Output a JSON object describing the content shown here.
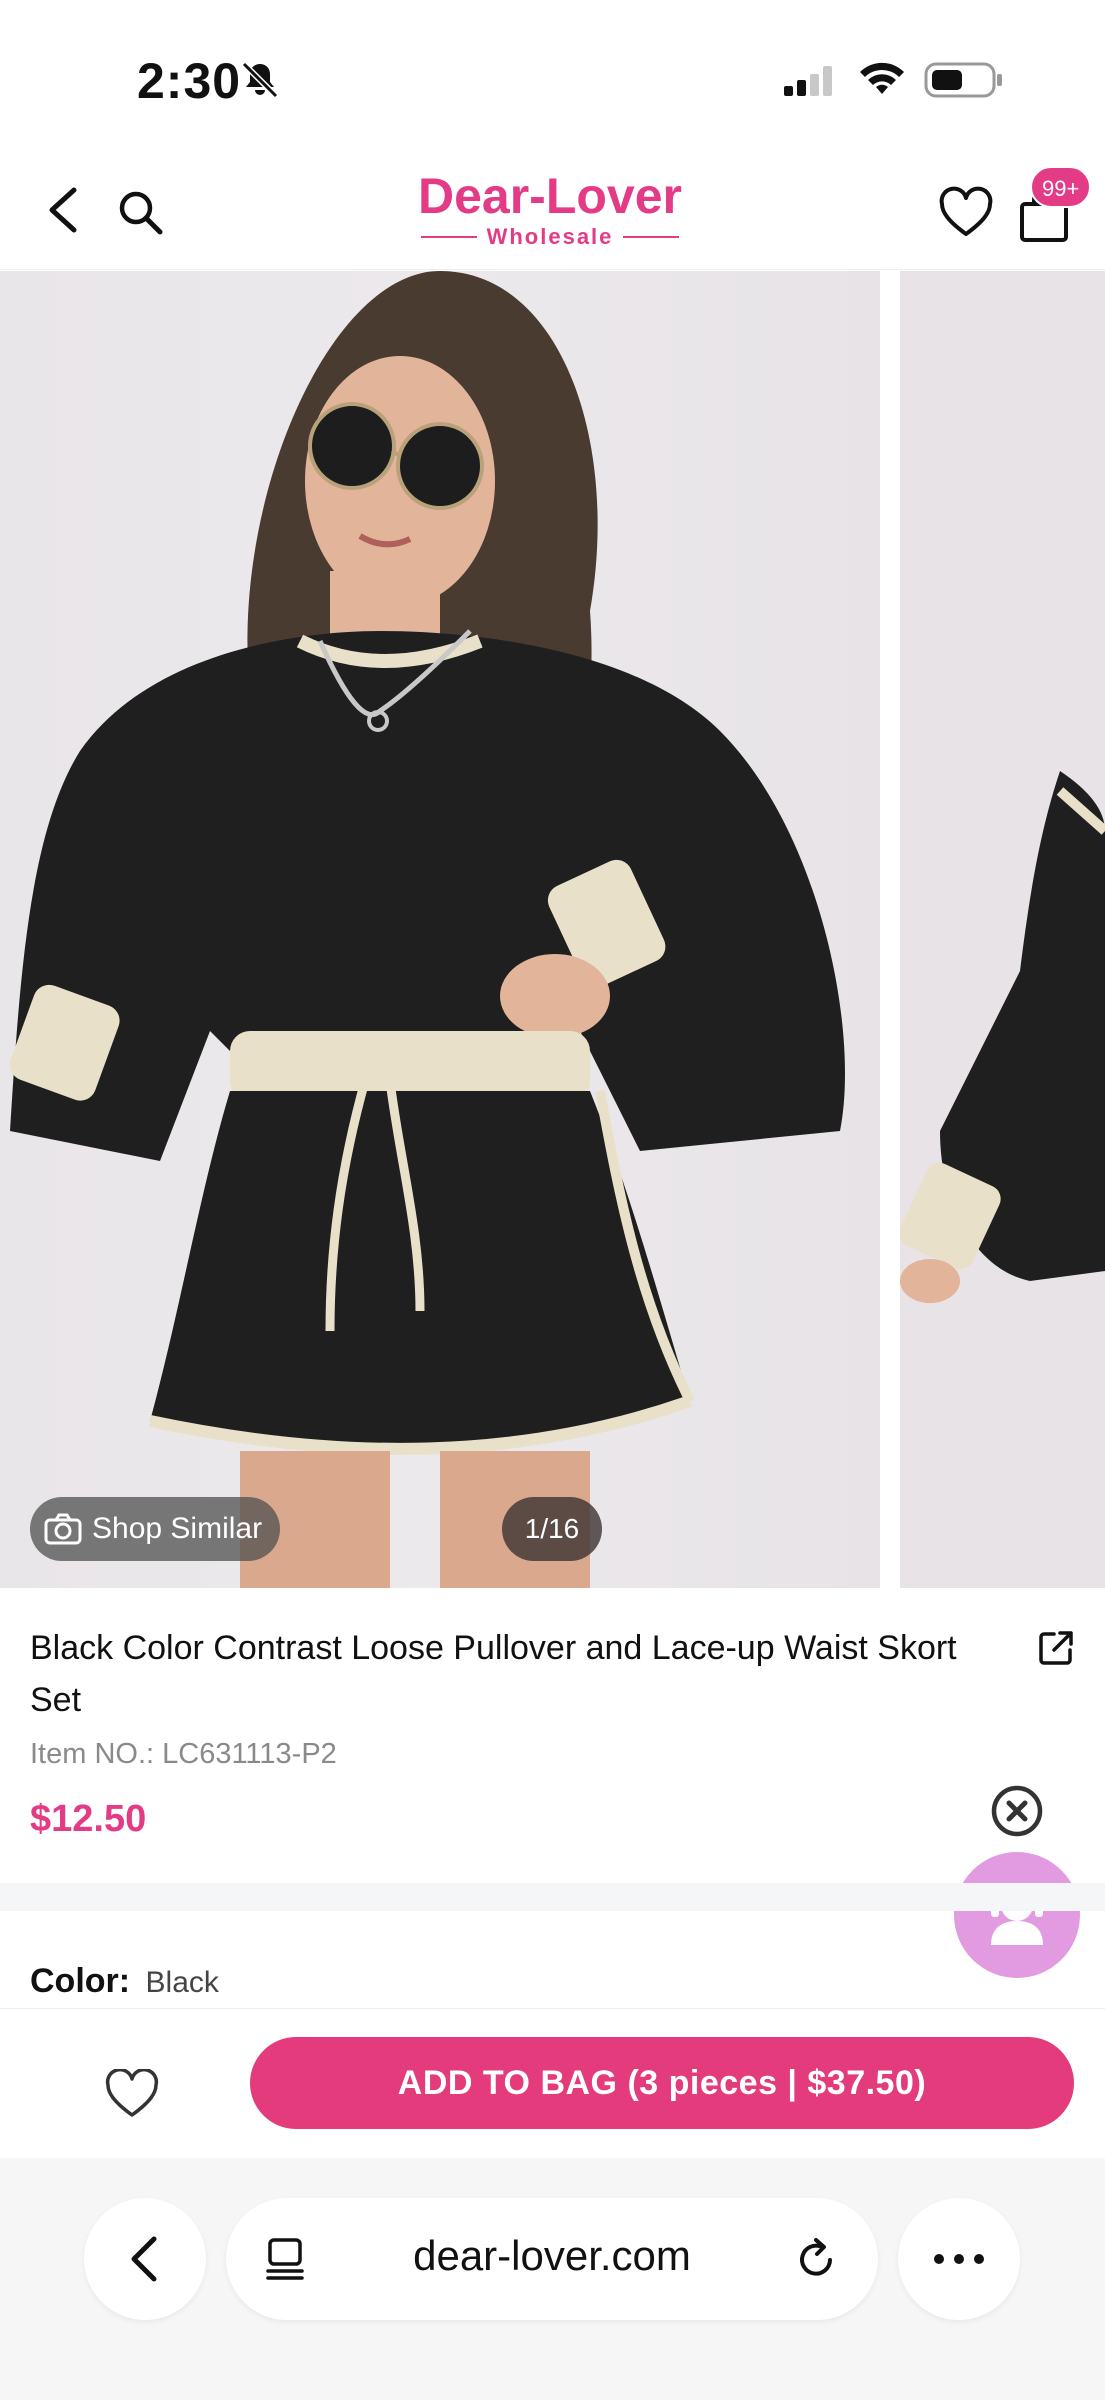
{
  "status_bar": {
    "time": "2:30"
  },
  "header": {
    "logo_main": "Dear-Lover",
    "logo_sub": "Wholesale",
    "bag_badge": "99+"
  },
  "gallery": {
    "shop_similar_label": "Shop Similar",
    "counter": "1/16"
  },
  "product": {
    "title": "Black Color Contrast Loose Pullover and Lace-up Waist Skort Set",
    "item_no": "Item NO.: LC631113-P2",
    "price": "$12.50"
  },
  "options": {
    "color_label": "Color:",
    "color_value": "Black"
  },
  "action_bar": {
    "add_to_bag_label": "ADD TO BAG (3 pieces | $37.50)"
  },
  "browser": {
    "url": "dear-lover.com"
  },
  "colors": {
    "brand_pink": "#e33b86",
    "button_pink": "#e33b7c",
    "support_bubble": "#e29ae0"
  },
  "icons": {
    "status": [
      "bell-off-icon",
      "cellular-signal-icon",
      "wifi-icon",
      "battery-icon"
    ],
    "header": [
      "back-arrow-icon",
      "search-icon",
      "heart-icon",
      "shopping-bag-icon"
    ],
    "gallery": [
      "camera-icon"
    ],
    "info": [
      "share-icon",
      "close-circle-icon",
      "customer-support-icon"
    ],
    "browser": [
      "chevron-left-icon",
      "tabs-icon",
      "reload-icon",
      "more-dots-icon"
    ]
  }
}
